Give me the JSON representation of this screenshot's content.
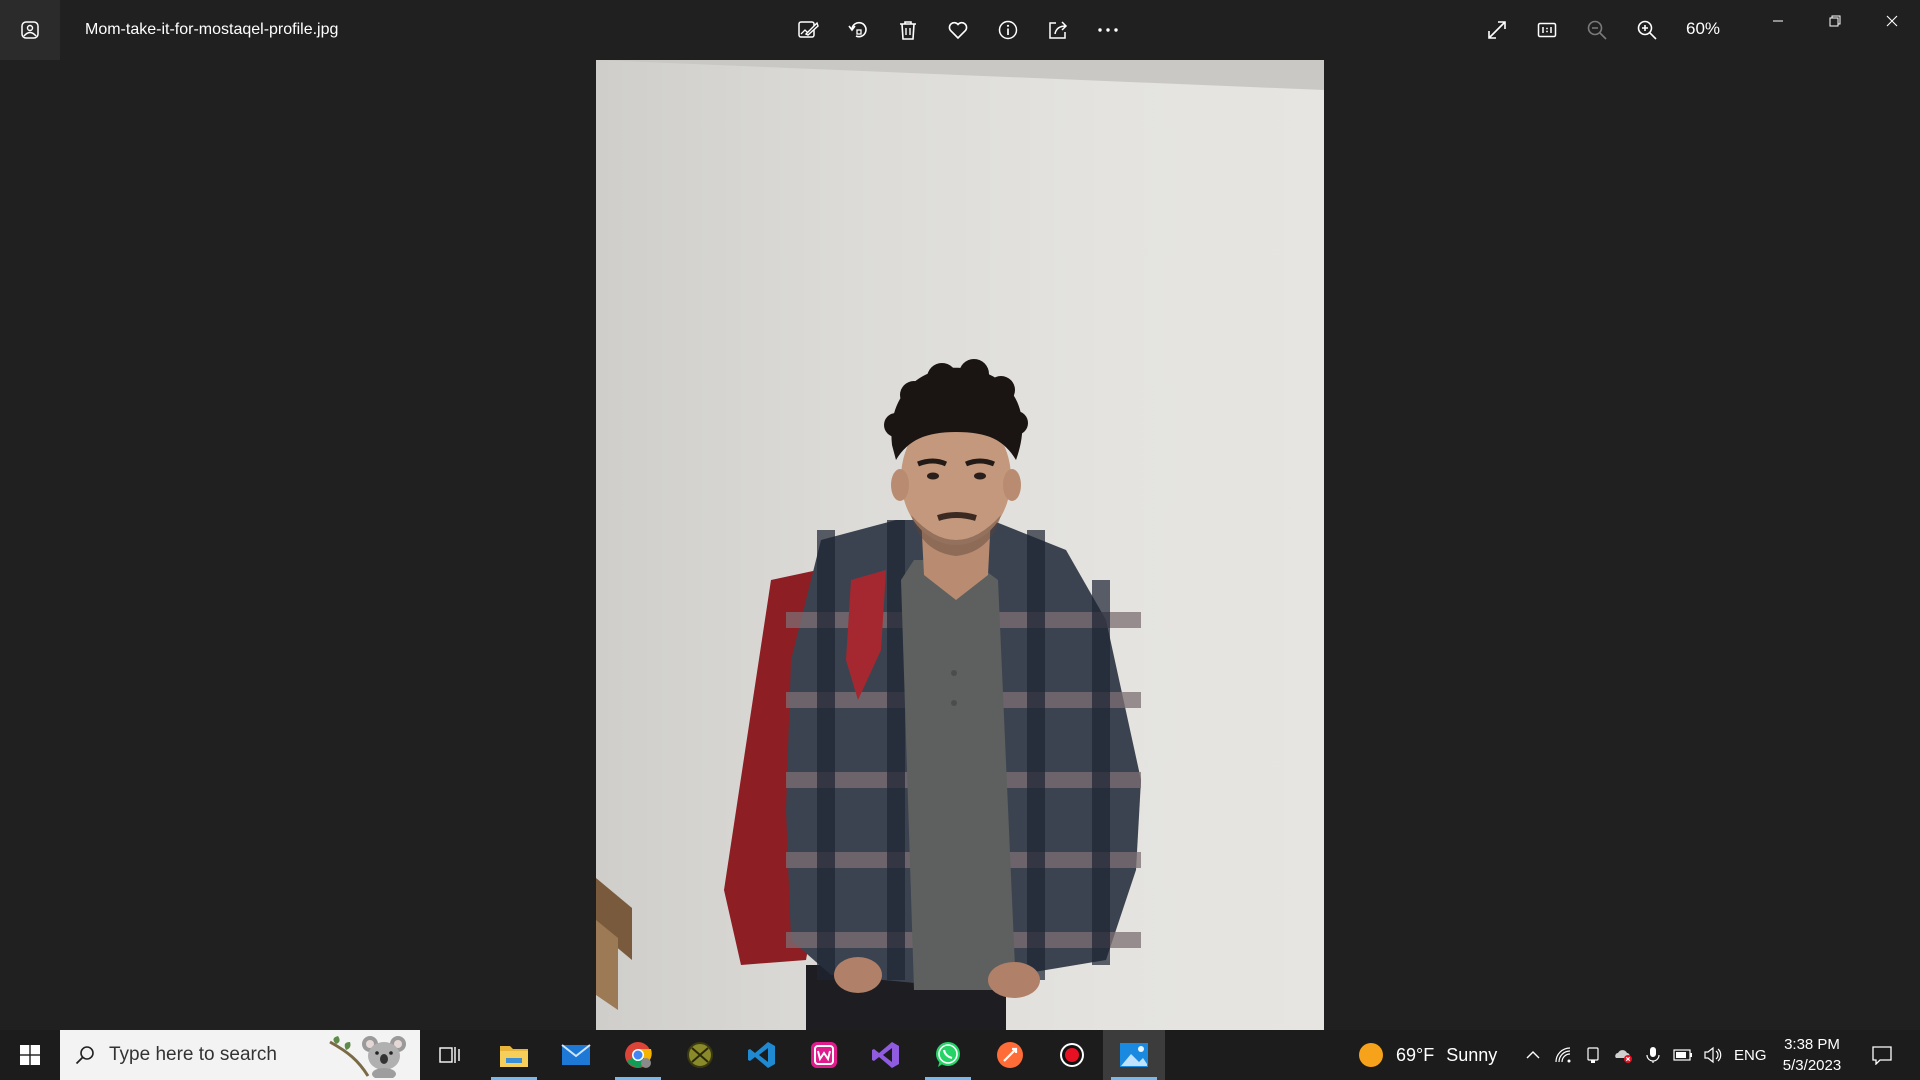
{
  "window": {
    "file_name": "Mom-take-it-for-mostaqel-profile.jpg",
    "zoom_level": "60%"
  },
  "toolbar": {
    "items": [
      "edit-create-icon",
      "rotate-icon",
      "delete-icon",
      "favorite-icon",
      "info-icon",
      "share-icon",
      "more-options-icon"
    ]
  },
  "view_controls": [
    "expand-icon",
    "actual-size-icon",
    "zoom-out-icon",
    "zoom-in-icon"
  ],
  "taskbar": {
    "search_placeholder": "Type here to search",
    "apps": [
      "file-explorer",
      "mail",
      "chrome",
      "xbox-app",
      "vs-code",
      "wampserver",
      "visual-studio",
      "whatsapp",
      "postman",
      "screen-recorder",
      "photos"
    ],
    "weather": {
      "temp": "69°F",
      "condition": "Sunny"
    },
    "language": "ENG",
    "time": "3:38 PM",
    "date": "5/3/2023"
  },
  "colors": {
    "accent": "#76b9ed",
    "titlebar": "#202020",
    "taskbar": "#1c1c1c"
  }
}
